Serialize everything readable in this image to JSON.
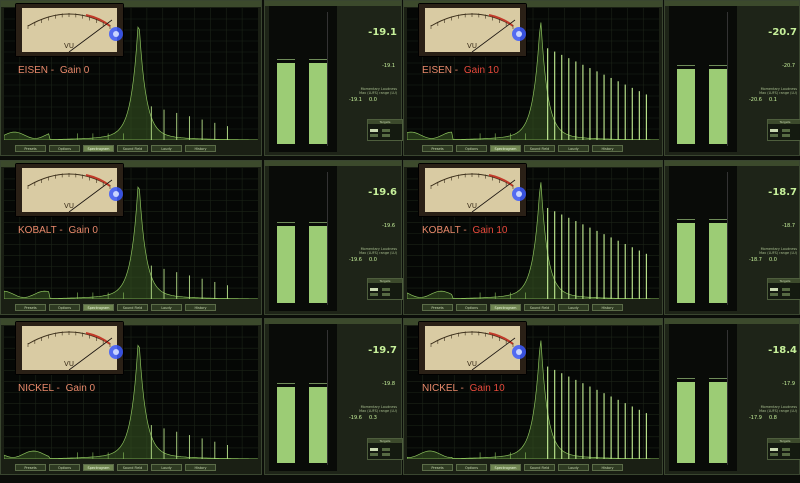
{
  "buttons": [
    "Presets",
    "Options",
    "Spectrogram",
    "Sound Field",
    "Loudy",
    "History"
  ],
  "active_button": "Spectrogram",
  "vu_scale": "VU",
  "meter_titles": {
    "momentary": "Momentary Loudness",
    "max": "Max (LUFS) range (LU)",
    "target": "Targets"
  },
  "rows": [
    {
      "material": "EISEN",
      "gain_text": "Gain 0",
      "gain_red": false,
      "gain10_material": "EISEN",
      "gain10_text": "Gain 10",
      "left": {
        "integrated": "-19.1",
        "short": "-19.1",
        "max": "-19.1",
        "range": "0.0",
        "bar_level": 0.62
      },
      "right": {
        "integrated": "-20.7",
        "short": "-20.7",
        "max": "-20.6",
        "range": "0.1",
        "bar_level": 0.58
      }
    },
    {
      "material": "KOBALT",
      "gain_text": "Gain 0",
      "gain_red": false,
      "gain10_material": "KOBALT",
      "gain10_text": "Gain 10",
      "left": {
        "integrated": "-19.6",
        "short": "-19.6",
        "max": "-19.6",
        "range": "0.0",
        "bar_level": 0.6
      },
      "right": {
        "integrated": "-18.7",
        "short": "-18.7",
        "max": "-18.7",
        "range": "0.0",
        "bar_level": 0.62
      }
    },
    {
      "material": "NICKEL",
      "gain_text": "Gain 0",
      "gain_red": false,
      "gain10_material": "NICKEL",
      "gain10_text": "Gain 10",
      "left": {
        "integrated": "-19.7",
        "short": "-19.8",
        "max": "-19.6",
        "range": "0.3",
        "bar_level": 0.58
      },
      "right": {
        "integrated": "-18.4",
        "short": "-17.9",
        "max": "-17.9",
        "range": "0.8",
        "bar_level": 0.62
      }
    }
  ],
  "colors": {
    "bar": "#9ccc75",
    "spectrum": "#7fae55",
    "label": "#e98a6b",
    "gain_red": "#e84a3c",
    "value": "#c6f09a"
  }
}
